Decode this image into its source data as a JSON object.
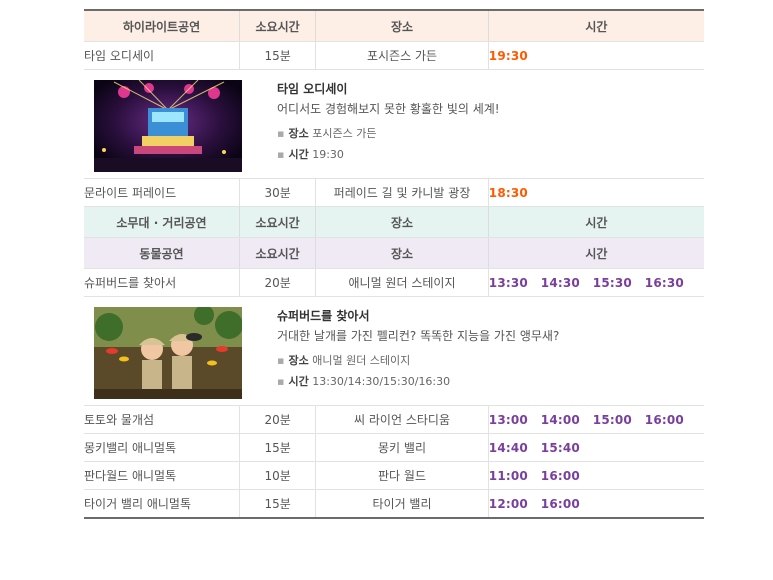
{
  "headers": {
    "highlight": [
      "하이라이트공연",
      "소요시간",
      "장소",
      "시간"
    ],
    "stage": [
      "소무대 · 거리공연",
      "소요시간",
      "장소",
      "시간"
    ],
    "animal": [
      "동물공연",
      "소요시간",
      "장소",
      "시간"
    ]
  },
  "highlight_rows": [
    {
      "name": "타임 오디세이",
      "duration": "15분",
      "place": "포시즌스 가든",
      "times": [
        "19:30"
      ]
    }
  ],
  "detail1": {
    "title": "타임 오디세이",
    "desc": "어디서도 경험해보지 못한 황홀한 빛의 세계!",
    "place_label": "장소",
    "place": "포시즌스 가든",
    "time_label": "시간",
    "time": "19:30"
  },
  "parade_row": {
    "name": "문라이트 퍼레이드",
    "duration": "30분",
    "place": "퍼레이드 길 및 카니발 광장",
    "times": [
      "18:30"
    ]
  },
  "animal_rows": [
    {
      "name": "슈퍼버드를 찾아서",
      "duration": "20분",
      "place": "애니멀 원더 스테이지",
      "times": [
        "13:30",
        "14:30",
        "15:30",
        "16:30"
      ]
    }
  ],
  "detail2": {
    "title": "슈퍼버드를 찾아서",
    "desc": "거대한 날개를 가진 펠리컨? 똑똑한 지능을 가진 앵무새?",
    "place_label": "장소",
    "place": "애니멀 원더 스테이지",
    "time_label": "시간",
    "time": "13:30/14:30/15:30/16:30"
  },
  "animal_rows2": [
    {
      "name": "토토와 물개섬",
      "duration": "20분",
      "place": "씨 라이언 스타디움",
      "times": [
        "13:00",
        "14:00",
        "15:00",
        "16:00"
      ]
    },
    {
      "name": "몽키밸리 애니멀톡",
      "duration": "15분",
      "place": "몽키 밸리",
      "times": [
        "14:40",
        "15:40"
      ]
    },
    {
      "name": "판다월드 애니멀톡",
      "duration": "10분",
      "place": "판다 월드",
      "times": [
        "11:00",
        "16:00"
      ]
    },
    {
      "name": "타이거 밸리 애니멀톡",
      "duration": "15분",
      "place": "타이거 밸리",
      "times": [
        "12:00",
        "16:00"
      ]
    }
  ],
  "colors": {
    "highlight_time": "#ff5a00",
    "animal_time": "#7a3e9d"
  }
}
